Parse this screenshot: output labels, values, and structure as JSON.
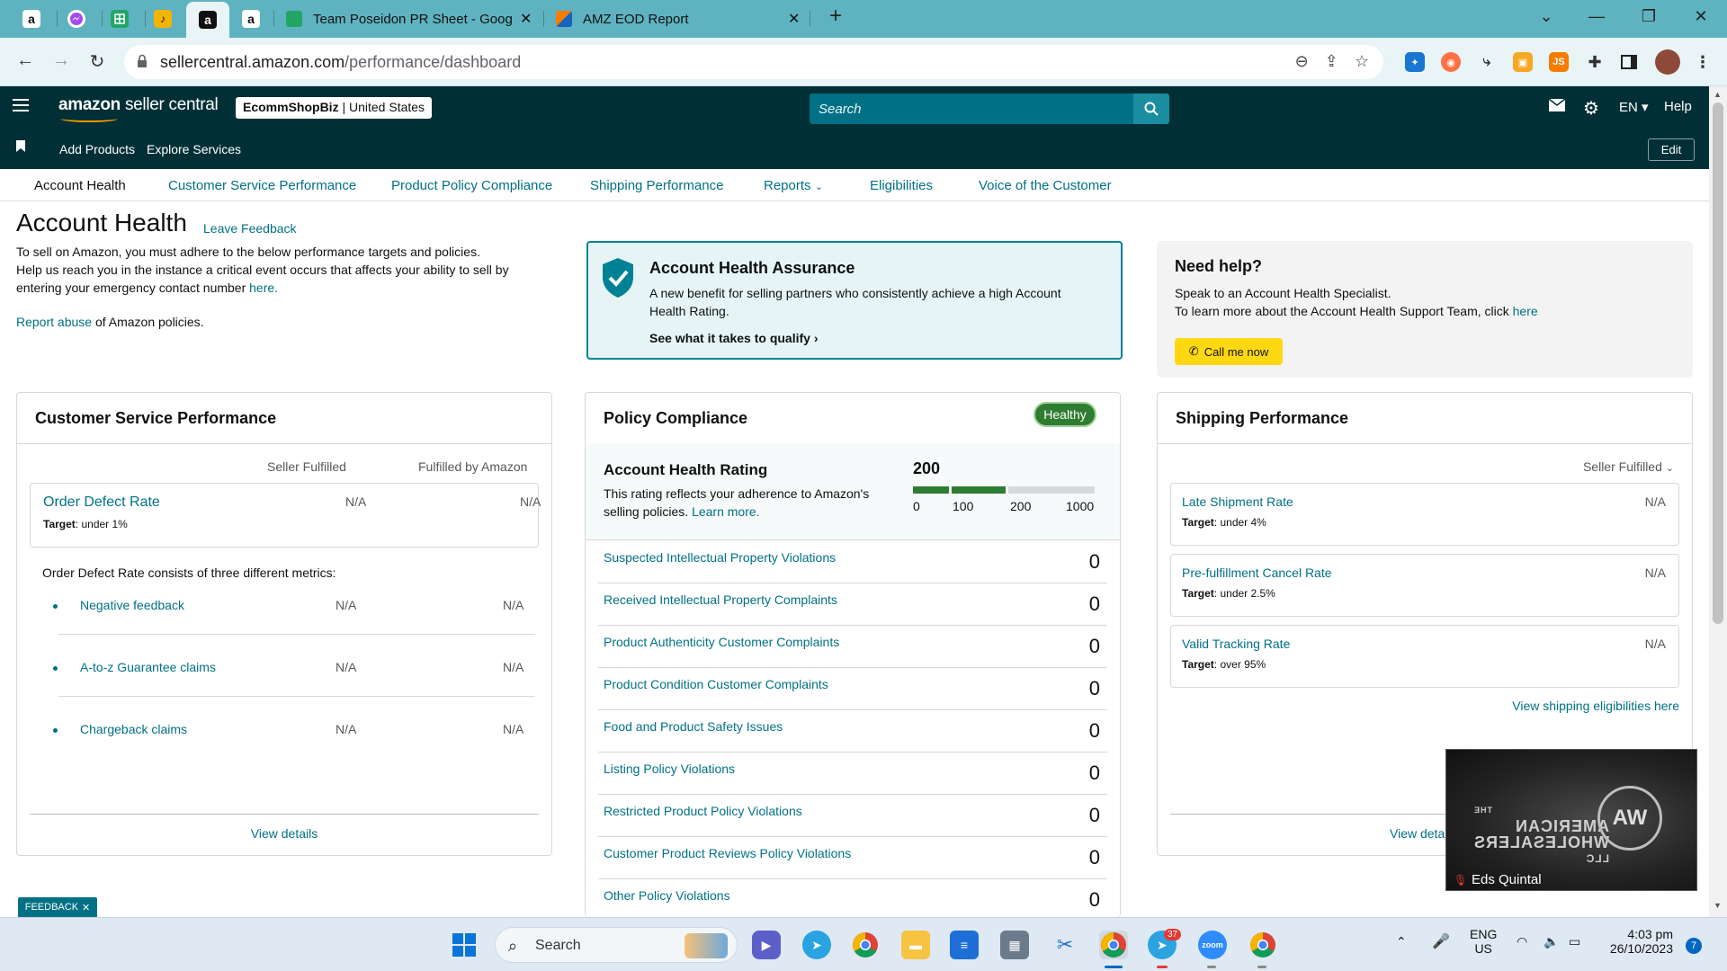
{
  "browser": {
    "tabs": [
      {
        "icon": "amazon-icon",
        "label": "a"
      },
      {
        "icon": "messenger-icon",
        "label": ""
      },
      {
        "icon": "google-sheets-icon",
        "label": ""
      },
      {
        "icon": "extension-icon",
        "label": ""
      },
      {
        "icon": "amazon-icon",
        "label": "a"
      },
      {
        "icon": "amazon-icon",
        "label": "a"
      },
      {
        "icon": "google-sheets-icon",
        "label": "Team Poseidon PR Sheet - Goog"
      },
      {
        "icon": "app-icon",
        "label": "AMZ EOD Report"
      }
    ],
    "url_host": "sellercentral.amazon.com",
    "url_path": "/performance/dashboard"
  },
  "header": {
    "logo_main": "amazon",
    "logo_sub": "seller central",
    "store_name": "EcommShopBiz",
    "store_region": "United States",
    "search_placeholder": "Search",
    "language": "EN",
    "help": "Help"
  },
  "subheader": {
    "links": [
      "Add Products",
      "Explore Services"
    ],
    "edit": "Edit"
  },
  "nav_tabs": [
    "Account Health",
    "Customer Service Performance",
    "Product Policy Compliance",
    "Shipping Performance",
    "Reports",
    "Eligibilities",
    "Voice of the Customer"
  ],
  "intro": {
    "title": "Account Health",
    "leave_feedback": "Leave Feedback",
    "line1": "To sell on Amazon, you must adhere to the below performance targets and policies.",
    "line2": "Help us reach you in the instance a critical event occurs that affects your ability to sell by entering your emergency contact number",
    "here": "here.",
    "report_abuse": "Report abuse",
    "report_abuse_suffix": "of Amazon policies."
  },
  "assurance": {
    "title": "Account Health Assurance",
    "desc": "A new benefit for selling partners who consistently achieve a high Account Health Rating.",
    "link": "See what it takes to qualify"
  },
  "need_help": {
    "title": "Need help?",
    "line1": "Speak to an Account Health Specialist.",
    "line2": "To learn more about the Account Health Support Team, click",
    "here": "here",
    "call_btn": "Call me now"
  },
  "customer_service": {
    "title": "Customer Service Performance",
    "col_seller": "Seller Fulfilled",
    "col_fba": "Fulfilled by Amazon",
    "odr_name": "Order Defect Rate",
    "odr_target_label": "Target",
    "odr_target": ": under 1%",
    "odr_seller": "N/A",
    "odr_fba": "N/A",
    "sub_text": "Order Defect Rate consists of three different metrics:",
    "metrics": [
      {
        "name": "Negative feedback",
        "seller": "N/A",
        "fba": "N/A"
      },
      {
        "name": "A-to-z Guarantee claims",
        "seller": "N/A",
        "fba": "N/A"
      },
      {
        "name": "Chargeback claims",
        "seller": "N/A",
        "fba": "N/A"
      }
    ],
    "view_details": "View details"
  },
  "policy": {
    "title": "Policy Compliance",
    "badge": "Healthy",
    "ahr_title": "Account Health Rating",
    "ahr_desc": "This rating reflects your adherence to Amazon's selling policies.",
    "learn_more": "Learn more.",
    "score": "200",
    "ticks": [
      "0",
      "100",
      "200",
      "1000"
    ],
    "rows": [
      {
        "name": "Suspected Intellectual Property Violations",
        "value": "0"
      },
      {
        "name": "Received Intellectual Property Complaints",
        "value": "0"
      },
      {
        "name": "Product Authenticity Customer Complaints",
        "value": "0"
      },
      {
        "name": "Product Condition Customer Complaints",
        "value": "0"
      },
      {
        "name": "Food and Product Safety Issues",
        "value": "0"
      },
      {
        "name": "Listing Policy Violations",
        "value": "0"
      },
      {
        "name": "Restricted Product Policy Violations",
        "value": "0"
      },
      {
        "name": "Customer Product Reviews Policy Violations",
        "value": "0"
      },
      {
        "name": "Other Policy Violations",
        "value": "0"
      }
    ]
  },
  "shipping": {
    "title": "Shipping Performance",
    "selector": "Seller Fulfilled",
    "metrics": [
      {
        "name": "Late Shipment Rate",
        "target": ": under 4%",
        "value": "N/A"
      },
      {
        "name": "Pre-fulfillment Cancel Rate",
        "target": ": under 2.5%",
        "value": "N/A"
      },
      {
        "name": "Valid Tracking Rate",
        "target": ": over 95%",
        "value": "N/A"
      }
    ],
    "target_label": "Target",
    "eligibilities": "View shipping eligibilities here",
    "view_details_partial": "View deta"
  },
  "feedback_tab": "FEEDBACK",
  "video": {
    "participant": "Eds Quintal",
    "logo_line1": "THE",
    "logo_line2": "AMERICAN",
    "logo_line3": "WHOLESALERS",
    "logo_line4": "LLC"
  },
  "taskbar": {
    "search": "Search",
    "lang1": "ENG",
    "lang2": "US",
    "time": "4:03 pm",
    "date": "26/10/2023",
    "telegram_badge": "37",
    "notif_count": "7"
  },
  "colors": {
    "header_bg": "#002f36",
    "link": "#007185",
    "healthy": "#2f7d32",
    "call_btn": "#ffd814",
    "tabbar": "#5fb3c0"
  }
}
